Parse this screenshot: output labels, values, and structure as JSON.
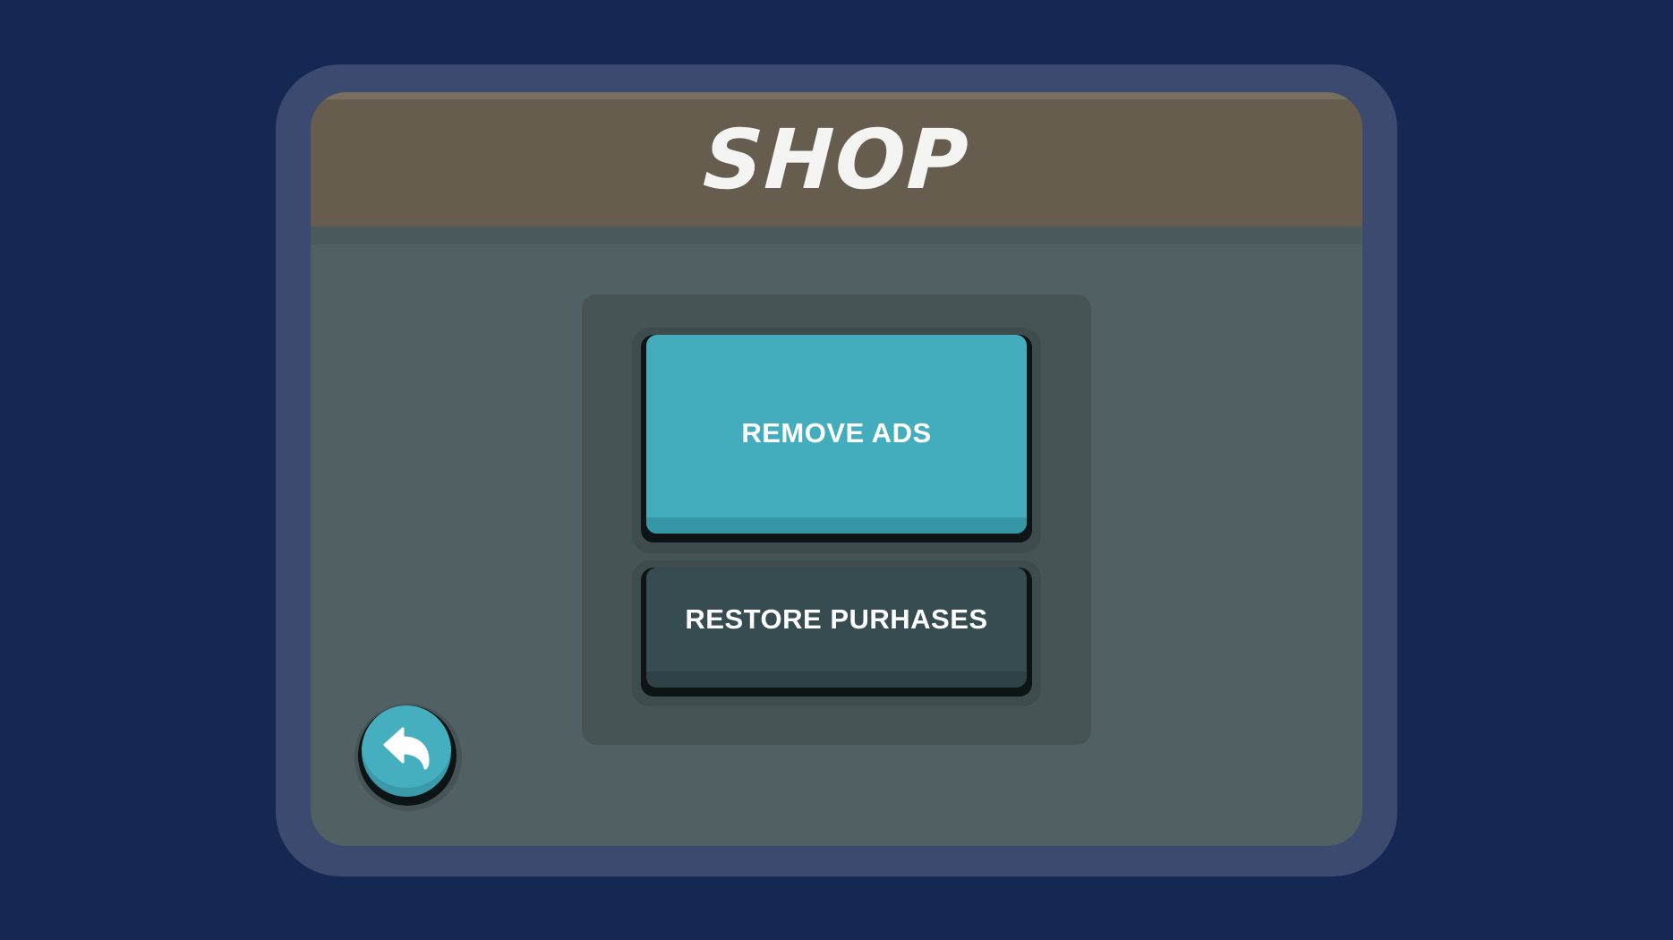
{
  "screen": {
    "title": "SHOP"
  },
  "shop": {
    "remove_ads_label": "REMOVE ADS",
    "restore_purchases_label": "RESTORE PURHASES"
  },
  "navigation": {
    "back_icon": "back-arrow-icon"
  },
  "colors": {
    "background": "#152853",
    "frame": "#3c4a6f",
    "panel": "#506063",
    "header": "#665d4f",
    "accent_button": "#43adbd",
    "dark_button": "#374c50",
    "text": "#ffffff"
  }
}
